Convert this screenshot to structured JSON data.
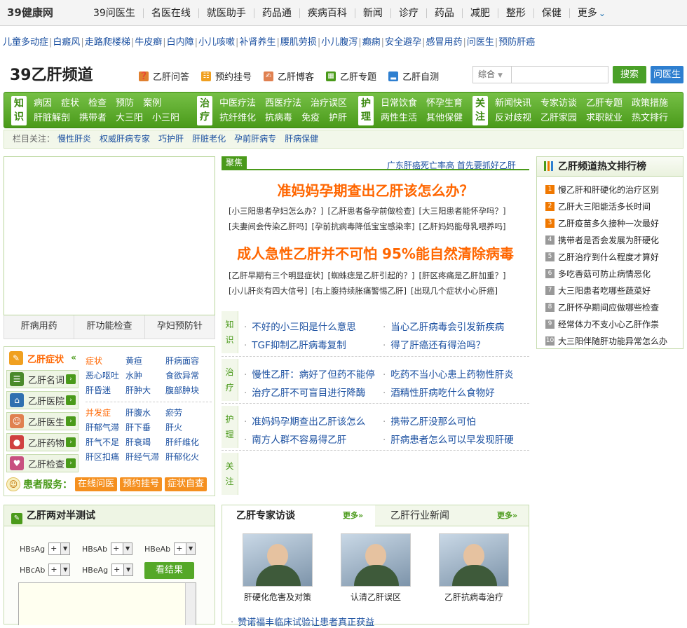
{
  "brand": {
    "site_logo": "39健康网",
    "channel_logo_num": "39",
    "channel_logo_text": "39乙肝频道"
  },
  "topnav": {
    "items": [
      "39问医生",
      "名医在线",
      "就医助手",
      "药品通",
      "疾病百科",
      "新闻",
      "诊疗",
      "药品",
      "减肥",
      "整形",
      "保健"
    ],
    "more": "更多"
  },
  "kwlinks": [
    "儿童多动症",
    "白癜风",
    "走路爬楼梯",
    "牛皮癣",
    "白内障",
    "小儿咳嗽",
    "补肾养生",
    "腰肌劳损",
    "小儿腹泻",
    "癫痫",
    "安全避孕",
    "感冒用药",
    "问医生",
    "预防肝癌"
  ],
  "chlinks": [
    {
      "label": "乙肝问答"
    },
    {
      "label": "预约挂号"
    },
    {
      "label": "乙肝博客"
    },
    {
      "label": "乙肝专题"
    },
    {
      "label": "乙肝自测"
    }
  ],
  "search": {
    "select": "综合",
    "button": "搜索",
    "ask_button": "问医生"
  },
  "mainnav": [
    {
      "tag": "知识",
      "rows": [
        [
          "病因",
          "症状",
          "检查",
          "预防",
          "案例"
        ],
        [
          "肝脏解剖",
          "携带者",
          "大三阳",
          "小三阳"
        ]
      ]
    },
    {
      "tag": "治疗",
      "rows": [
        [
          "中医疗法",
          "西医疗法",
          "治疗误区"
        ],
        [
          "抗纤维化",
          "抗病毒",
          "免疫",
          "护肝"
        ]
      ]
    },
    {
      "tag": "护理",
      "rows": [
        [
          "日常饮食",
          "怀孕生育"
        ],
        [
          "两性生活",
          "其他保健"
        ]
      ]
    },
    {
      "tag": "关注",
      "rows": [
        [
          "新闻快讯",
          "专家访谈",
          "乙肝专题",
          "政策措施"
        ],
        [
          "反对歧视",
          "乙肝家园",
          "求职就业",
          "热文排行"
        ]
      ]
    }
  ],
  "focus_bar": {
    "label": "栏目关注：",
    "links": [
      "慢性肝炎",
      "权威肝病专家",
      "巧护肝",
      "肝脏老化",
      "孕前肝病专",
      "肝病保健"
    ]
  },
  "img_tabs": [
    "肝病用药",
    "肝功能检查",
    "孕妇预防针"
  ],
  "side_menu": {
    "items": [
      {
        "label": "乙肝症状",
        "icon": "✎",
        "color": "#f0a020"
      },
      {
        "label": "乙肝名词",
        "icon": "☰",
        "color": "#4a8a2a"
      },
      {
        "label": "乙肝医院",
        "icon": "⌂",
        "color": "#3070b0"
      },
      {
        "label": "乙肝医生",
        "icon": "☺",
        "color": "#e08050"
      },
      {
        "label": "乙肝药物",
        "icon": "●",
        "color": "#d04040"
      },
      {
        "label": "乙肝检查",
        "icon": "♥",
        "color": "#c85080"
      }
    ],
    "group1": [
      "症状",
      "黄疸",
      "肝病面容",
      "恶心呕吐",
      "水肿",
      "食欲异常",
      "肝昏迷",
      "肝肿大",
      "腹部肿块"
    ],
    "group2": [
      "并发症",
      "肝腹水",
      "瘀劳",
      "肝郁气滞",
      "肝下垂",
      "肝火",
      "肝气不足",
      "肝衰竭",
      "肝纤维化",
      "肝区扣痛",
      "肝经气滞",
      "肝郁化火"
    ],
    "patient_label": "患者服务：",
    "patient_buttons": [
      "在线问医",
      "预约挂号",
      "症状自查"
    ]
  },
  "test": {
    "title": "乙肝两对半测试",
    "fields": [
      {
        "label": "HBsAg",
        "value": "+"
      },
      {
        "label": "HBsAb",
        "value": "+"
      },
      {
        "label": "HBeAb",
        "value": "+"
      },
      {
        "label": "HBcAb",
        "value": "+"
      },
      {
        "label": "HBeAg",
        "value": "+"
      }
    ],
    "button": "看结果"
  },
  "focus": {
    "tag": "聚焦",
    "headline_link": "广东肝癌死亡率高 首先要抓好乙肝",
    "h1": "准妈妈孕期查出乙肝该怎么办？",
    "links1": [
      [
        "小三阳患者孕妇怎么办？",
        "乙肝患者备孕前做检查",
        "大三阳患者能怀孕吗？"
      ],
      [
        "夫妻间会传染乙肝吗",
        "孕前抗病毒降低宝宝感染率",
        "乙肝妈妈能母乳喂养吗"
      ]
    ],
    "h2": "成人急性乙肝并不可怕 95%能自然清除病毒",
    "links2": [
      [
        "乙肝早期有三个明显症状",
        "蜘蛛痣是乙肝引起的？",
        "肝区疼痛是乙肝加重？"
      ],
      [
        "小儿肝炎有四大信号",
        "右上腹持续胀痛警惕乙肝",
        "出现几个症状小心肝癌"
      ]
    ]
  },
  "cats": [
    {
      "tag": "知识",
      "items": [
        "不好的小三阳是什么意思",
        "当心乙肝病毒会引发新疾病",
        "TGF抑制乙肝病毒复制",
        "得了肝癌还有得治吗？"
      ]
    },
    {
      "tag": "治疗",
      "items": [
        "慢性乙肝：病好了但药不能停",
        "吃药不当小心患上药物性肝炎",
        "治疗乙肝不可盲目进行降酶",
        "酒精性肝病吃什么食物好"
      ]
    },
    {
      "tag": "护理",
      "items": [
        "准妈妈孕期查出乙肝该怎么",
        "携带乙肝没那么可怕",
        "南方人群不容易得乙肝",
        "肝病患者怎么可以早发现肝硬"
      ]
    },
    {
      "tag": "关注",
      "items": []
    }
  ],
  "expert": {
    "tab_active": "乙肝专家访谈",
    "tab_other": "乙肝行业新闻",
    "more": "更多",
    "photos": [
      "肝硬化危害及对策",
      "认清乙肝误区",
      "乙肝抗病毒治疗"
    ],
    "bottom_link": "赞诺福丰临床试验让患者真正获益"
  },
  "rank": {
    "title": "乙肝频道热文排行榜",
    "items": [
      "慢乙肝和肝硬化的治疗区别",
      "乙肝大三阳能活多长时间",
      "乙肝疫苗多久接种一次最好",
      "携带者是否会发展为肝硬化",
      "乙肝治疗到什么程度才算好",
      "多吃香菇可防止病情恶化",
      "大三阳患者吃哪些蔬菜好",
      "乙肝怀孕期间应做哪些检查",
      "经常体力不支小心乙肝作祟",
      "大三阳伴随肝功能异常怎么办"
    ]
  },
  "colors": {
    "brand_green": "#4a9a1a",
    "accent_orange": "#ff6600",
    "link_blue": "#1a4fa0",
    "rank_highlight": "#f07800"
  }
}
